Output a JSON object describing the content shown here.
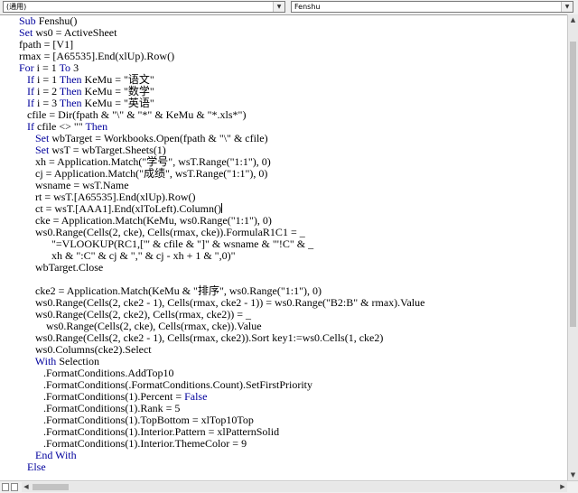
{
  "toolbar": {
    "object_combo": "(通用)",
    "proc_combo": "Fenshu",
    "dropdown_glyph": "▼"
  },
  "scroll_glyphs": {
    "up": "▲",
    "down": "▼",
    "left": "◀",
    "right": "▶"
  },
  "colors": {
    "keyword": "#00009c",
    "text": "#000000",
    "background": "#ffffff"
  },
  "code_lines": [
    [
      [
        "k",
        "Sub"
      ],
      [
        "t",
        " Fenshu()"
      ]
    ],
    [
      [
        "k",
        "Set"
      ],
      [
        "t",
        " ws0 = ActiveSheet"
      ]
    ],
    [
      [
        "t",
        "fpath = [V1]"
      ]
    ],
    [
      [
        "t",
        "rmax = [A65535].End(xlUp).Row()"
      ]
    ],
    [
      [
        "k",
        "For"
      ],
      [
        "t",
        " i = 1 "
      ],
      [
        "k",
        "To"
      ],
      [
        "t",
        " 3"
      ]
    ],
    [
      [
        "t",
        "   "
      ],
      [
        "k",
        "If"
      ],
      [
        "t",
        " i = 1 "
      ],
      [
        "k",
        "Then"
      ],
      [
        "t",
        " KeMu = \"语文\""
      ]
    ],
    [
      [
        "t",
        "   "
      ],
      [
        "k",
        "If"
      ],
      [
        "t",
        " i = 2 "
      ],
      [
        "k",
        "Then"
      ],
      [
        "t",
        " KeMu = \"数学\""
      ]
    ],
    [
      [
        "t",
        "   "
      ],
      [
        "k",
        "If"
      ],
      [
        "t",
        " i = 3 "
      ],
      [
        "k",
        "Then"
      ],
      [
        "t",
        " KeMu = \"英语\""
      ]
    ],
    [
      [
        "t",
        "   cfile = Dir(fpath & \"\\\" & \"*\" & KeMu & \"*.xls*\")"
      ]
    ],
    [
      [
        "t",
        "   "
      ],
      [
        "k",
        "If"
      ],
      [
        "t",
        " cfile <> \"\" "
      ],
      [
        "k",
        "Then"
      ]
    ],
    [
      [
        "t",
        "      "
      ],
      [
        "k",
        "Set"
      ],
      [
        "t",
        " wbTarget = Workbooks.Open(fpath & \"\\\" & cfile)"
      ]
    ],
    [
      [
        "t",
        "      "
      ],
      [
        "k",
        "Set"
      ],
      [
        "t",
        " wsT = wbTarget.Sheets(1)"
      ]
    ],
    [
      [
        "t",
        "      xh = Application.Match(\"学号\", wsT.Range(\"1:1\"), 0)"
      ]
    ],
    [
      [
        "t",
        "      cj = Application.Match(\"成绩\", wsT.Range(\"1:1\"), 0)"
      ]
    ],
    [
      [
        "t",
        "      wsname = wsT.Name"
      ]
    ],
    [
      [
        "t",
        "      rt = wsT.[A65535].End(xlUp).Row()"
      ]
    ],
    [
      [
        "t",
        "      ct = wsT.[AAA1].End(xlToLeft).Column()"
      ],
      [
        "c",
        ""
      ]
    ],
    [
      [
        "t",
        "      cke = Application.Match(KeMu, ws0.Range(\"1:1\"), 0)"
      ]
    ],
    [
      [
        "t",
        "      ws0.Range(Cells(2, cke), Cells(rmax, cke)).FormulaR1C1 = _"
      ]
    ],
    [
      [
        "t",
        "            \"=VLOOKUP(RC1,['\" & cfile & \"]\" & wsname & \"'!C\" & _"
      ]
    ],
    [
      [
        "t",
        "            xh & \":C\" & cj & \",\" & cj - xh + 1 & \",0)\""
      ]
    ],
    [
      [
        "t",
        "      wbTarget.Close"
      ]
    ],
    [
      [
        "t",
        ""
      ]
    ],
    [
      [
        "t",
        "      cke2 = Application.Match(KeMu & \"排序\", ws0.Range(\"1:1\"), 0)"
      ]
    ],
    [
      [
        "t",
        "      ws0.Range(Cells(2, cke2 - 1), Cells(rmax, cke2 - 1)) = ws0.Range(\"B2:B\" & rmax).Value"
      ]
    ],
    [
      [
        "t",
        "      ws0.Range(Cells(2, cke2), Cells(rmax, cke2)) = _"
      ]
    ],
    [
      [
        "t",
        "          ws0.Range(Cells(2, cke), Cells(rmax, cke)).Value"
      ]
    ],
    [
      [
        "t",
        "      ws0.Range(Cells(2, cke2 - 1), Cells(rmax, cke2)).Sort key1:=ws0.Cells(1, cke2)"
      ]
    ],
    [
      [
        "t",
        "      ws0.Columns(cke2).Select"
      ]
    ],
    [
      [
        "t",
        "      "
      ],
      [
        "k",
        "With"
      ],
      [
        "t",
        " Selection"
      ]
    ],
    [
      [
        "t",
        "         .FormatConditions.AddTop10"
      ]
    ],
    [
      [
        "t",
        "         .FormatConditions(.FormatConditions.Count).SetFirstPriority"
      ]
    ],
    [
      [
        "t",
        "         .FormatConditions(1).Percent = "
      ],
      [
        "k",
        "False"
      ]
    ],
    [
      [
        "t",
        "         .FormatConditions(1).Rank = 5"
      ]
    ],
    [
      [
        "t",
        "         .FormatConditions(1).TopBottom = xlTop10Top"
      ]
    ],
    [
      [
        "t",
        "         .FormatConditions(1).Interior.Pattern = xlPatternSolid"
      ]
    ],
    [
      [
        "t",
        "         .FormatConditions(1).Interior.ThemeColor = 9"
      ]
    ],
    [
      [
        "t",
        "      "
      ],
      [
        "k",
        "End With"
      ]
    ],
    [
      [
        "t",
        "   "
      ],
      [
        "k",
        "Else"
      ]
    ]
  ]
}
